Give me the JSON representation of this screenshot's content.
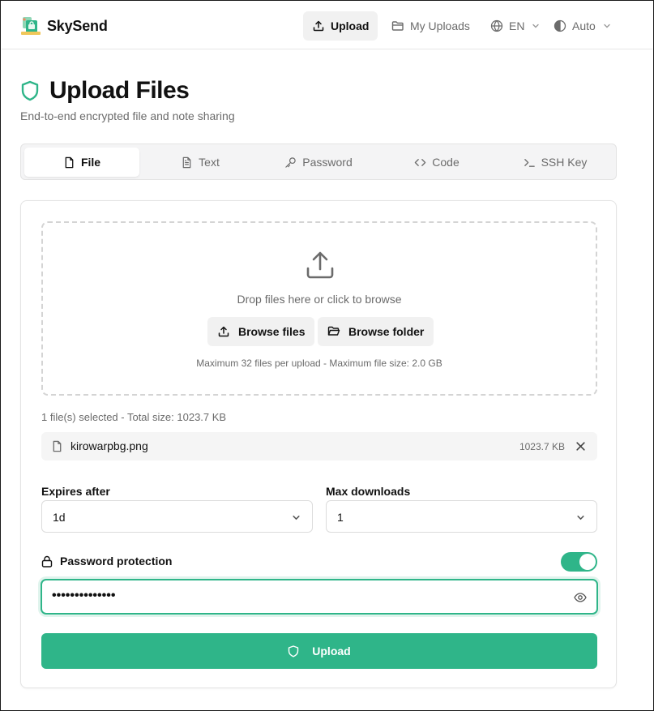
{
  "app": {
    "name": "SkySend",
    "accent_color": "#2fb589"
  },
  "nav": {
    "items": [
      {
        "label": "Upload",
        "icon": "upload-icon",
        "active": true
      },
      {
        "label": "My Uploads",
        "icon": "folder-icon",
        "active": false
      },
      {
        "label": "EN",
        "icon": "globe-icon",
        "active": false
      },
      {
        "label": "Auto",
        "icon": "theme-icon",
        "active": false
      }
    ]
  },
  "page": {
    "title": "Upload Files",
    "subtitle": "End-to-end encrypted file and note sharing"
  },
  "tabs": [
    {
      "label": "File",
      "icon": "file-icon",
      "active": true
    },
    {
      "label": "Text",
      "icon": "text-file-icon",
      "active": false
    },
    {
      "label": "Password",
      "icon": "key-icon",
      "active": false
    },
    {
      "label": "Code",
      "icon": "code-icon",
      "active": false
    },
    {
      "label": "SSH Key",
      "icon": "terminal-icon",
      "active": false
    }
  ],
  "dropzone": {
    "text": "Drop files here or click to browse",
    "browse_files": "Browse files",
    "browse_folder": "Browse folder",
    "hint": "Maximum 32 files per upload - Maximum file size: 2.0 GB"
  },
  "selection": {
    "summary": "1 file(s) selected - Total size: 1023.7 KB",
    "files": [
      {
        "name": "kirowarpbg.png",
        "size": "1023.7 KB"
      }
    ]
  },
  "options": {
    "expires_label": "Expires after",
    "expires_value": "1d",
    "max_downloads_label": "Max downloads",
    "max_downloads_value": "1"
  },
  "password": {
    "label": "Password protection",
    "enabled": true,
    "masked_value": "••••••••••••••"
  },
  "submit": {
    "label": "Upload"
  }
}
